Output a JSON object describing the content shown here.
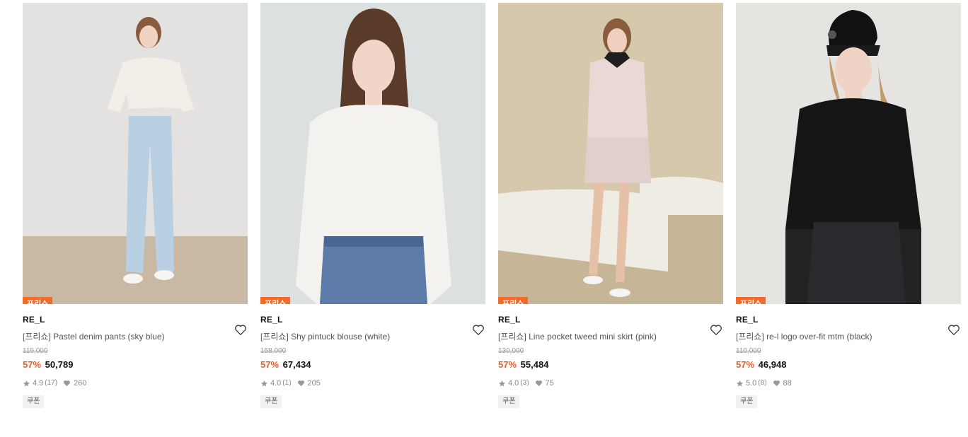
{
  "products": [
    {
      "badge": "프리쇼",
      "brand": "RE_L",
      "title": "[프리쇼] Pastel denim pants (sky blue)",
      "original_price": "119,000",
      "discount": "57%",
      "price": "50,789",
      "rating": "4.9",
      "review_count": "(17)",
      "likes": "260",
      "coupon": "쿠폰"
    },
    {
      "badge": "프리쇼",
      "brand": "RE_L",
      "title": "[프리쇼] Shy pintuck blouse (white)",
      "original_price": "158,000",
      "discount": "57%",
      "price": "67,434",
      "rating": "4.0",
      "review_count": "(1)",
      "likes": "205",
      "coupon": "쿠폰"
    },
    {
      "badge": "프리쇼",
      "brand": "RE_L",
      "title": "[프리쇼] Line pocket tweed mini skirt (pink)",
      "original_price": "130,000",
      "discount": "57%",
      "price": "55,484",
      "rating": "4.0",
      "review_count": "(3)",
      "likes": "75",
      "coupon": "쿠폰"
    },
    {
      "badge": "프리쇼",
      "brand": "RE_L",
      "title": "[프리쇼] re-l logo over-fit mtm (black)",
      "original_price": "110,000",
      "discount": "57%",
      "price": "46,948",
      "rating": "5.0",
      "review_count": "(8)",
      "likes": "88",
      "coupon": "쿠폰"
    }
  ],
  "colors": {
    "badge_bg": "#f36b2a",
    "discount": "#f05a23",
    "coupon_bg": "#f1f1f1"
  },
  "icons": {
    "wishlist": "heart-outline-icon",
    "rating": "star-icon",
    "likes": "heart-filled-icon"
  }
}
